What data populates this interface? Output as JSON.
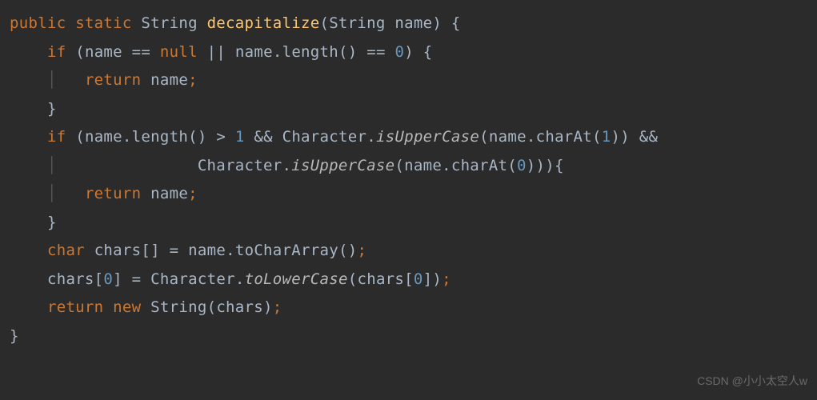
{
  "code": {
    "kw_public": "public",
    "kw_static": "static",
    "type_string": "String",
    "method_name": "decapitalize",
    "param_type": "String",
    "param_name": "name",
    "kw_if": "if",
    "kw_null": "null",
    "kw_return": "return",
    "kw_char": "char",
    "kw_new": "new",
    "var_name": "name",
    "var_chars": "chars",
    "m_length": "length",
    "m_charAt": "charAt",
    "m_toCharArray": "toCharArray",
    "cls_Character": "Character",
    "sm_isUpperCase": "isUpperCase",
    "sm_toLowerCase": "toLowerCase",
    "n0": "0",
    "n1": "1",
    "op_or": "||",
    "op_eqeq": "==",
    "op_gt": ">",
    "op_andand": "&&",
    "op_assign": "="
  },
  "watermark": "CSDN @小小太空人w"
}
